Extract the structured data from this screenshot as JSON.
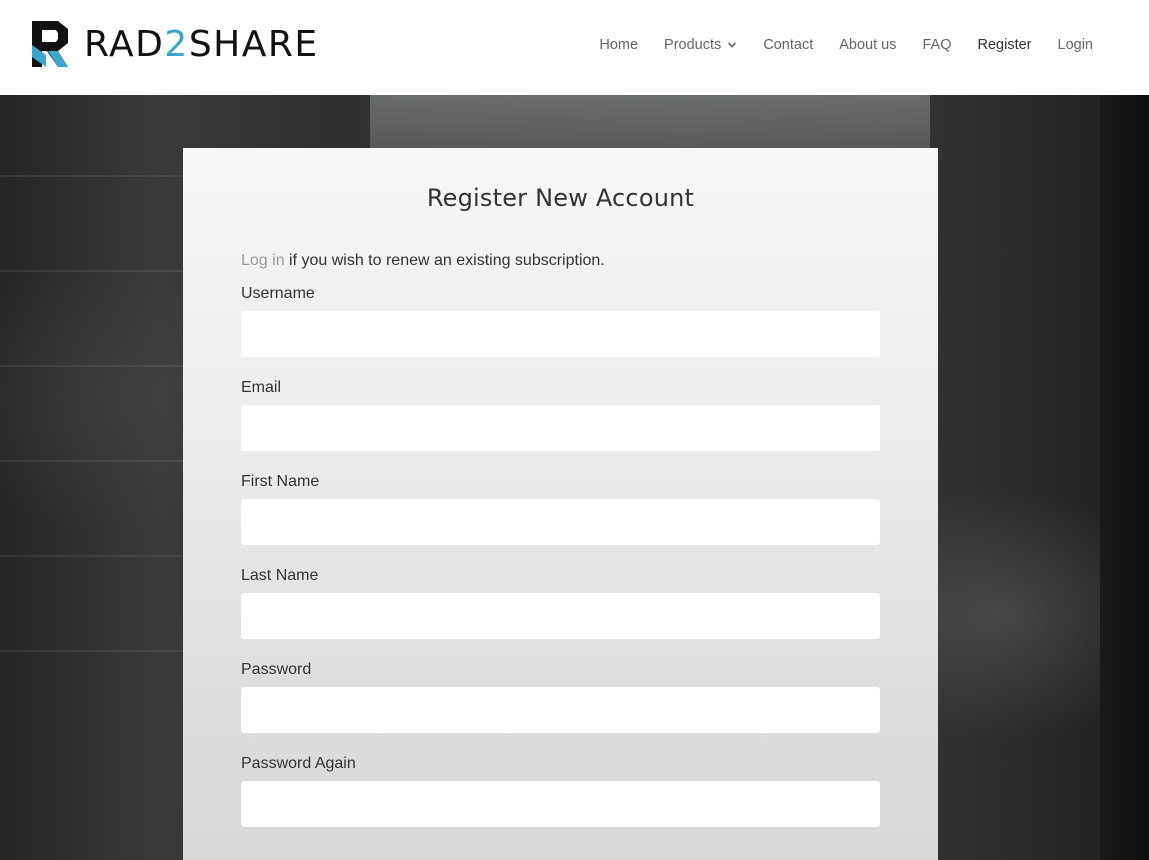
{
  "brand": {
    "name_part1": "RAD",
    "name_part2": "2",
    "name_part3": "SHARE",
    "accent_color": "#3aa6cc"
  },
  "nav": {
    "items": [
      {
        "label": "Home"
      },
      {
        "label": "Products",
        "icon": "chevron-down-icon"
      },
      {
        "label": "Contact"
      },
      {
        "label": "About us"
      },
      {
        "label": "FAQ"
      },
      {
        "label": "Register",
        "active": true
      },
      {
        "label": "Login"
      }
    ]
  },
  "form": {
    "title": "Register New Account",
    "login_link": "Log in",
    "intro_text": " if you wish to renew an existing subscription.",
    "fields": [
      {
        "label": "Username",
        "value": ""
      },
      {
        "label": "Email",
        "value": ""
      },
      {
        "label": "First Name",
        "value": ""
      },
      {
        "label": "Last Name",
        "value": ""
      },
      {
        "label": "Password",
        "value": ""
      },
      {
        "label": "Password Again",
        "value": ""
      }
    ]
  }
}
